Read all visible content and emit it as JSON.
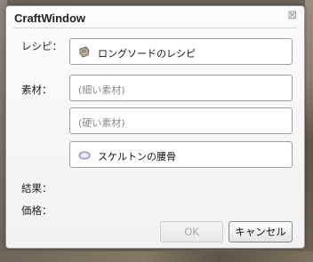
{
  "window": {
    "title": "CraftWindow",
    "close_glyph": "⊠"
  },
  "recipe": {
    "label": "レシピ：",
    "value": "ロングソードのレシピ",
    "icon": "scroll-icon"
  },
  "materials": {
    "label": "素材：",
    "slots": [
      {
        "placeholder": "(細い素材)"
      },
      {
        "placeholder": "(硬い素材)"
      },
      {
        "value": "スケルトンの腰骨",
        "icon": "bone-icon"
      }
    ]
  },
  "result": {
    "label": "結果："
  },
  "price": {
    "label": "価格："
  },
  "buttons": {
    "ok": "OK",
    "cancel": "キャンセル"
  }
}
